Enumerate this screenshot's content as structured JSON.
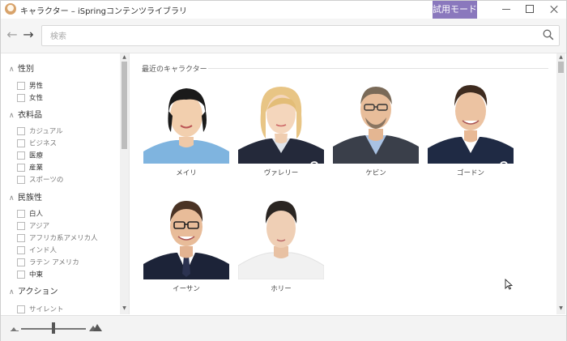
{
  "window": {
    "title": "キャラクター – iSpringコンテンツライブラリ",
    "trial_badge": "試用モード",
    "accent_color": "#8a78bd"
  },
  "toolbar": {
    "back_icon": "←",
    "forward_icon": "→",
    "search_placeholder": "検索"
  },
  "sidebar": {
    "groups": [
      {
        "title": "性別",
        "chevron": "∧",
        "items": [
          {
            "label": "男性"
          },
          {
            "label": "女性"
          }
        ]
      },
      {
        "title": "衣料品",
        "chevron": "∧",
        "items": [
          {
            "label": "カジュアル"
          },
          {
            "label": "ビジネス"
          },
          {
            "label": "医療"
          },
          {
            "label": "産業"
          },
          {
            "label": "スポーツの"
          }
        ]
      },
      {
        "title": "民族性",
        "chevron": "∧",
        "items": [
          {
            "label": "白人"
          },
          {
            "label": "アジア"
          },
          {
            "label": "アフリカ系アメリカ人"
          },
          {
            "label": "インド人"
          },
          {
            "label": "ラテン アメリカ"
          },
          {
            "label": "中東"
          }
        ]
      },
      {
        "title": "アクション",
        "chevron": "∧",
        "items": [
          {
            "label": "サイレント"
          }
        ]
      }
    ]
  },
  "main": {
    "section_title": "最近のキャラクター",
    "characters": [
      {
        "name": "メイリ",
        "locked": false
      },
      {
        "name": "ヴァレリー",
        "locked": true
      },
      {
        "name": "ケビン",
        "locked": false
      },
      {
        "name": "ゴードン",
        "locked": true
      },
      {
        "name": "イーサン",
        "locked": false
      },
      {
        "name": "ホリー",
        "locked": false
      }
    ]
  },
  "zoom": {
    "level": 0.5
  }
}
